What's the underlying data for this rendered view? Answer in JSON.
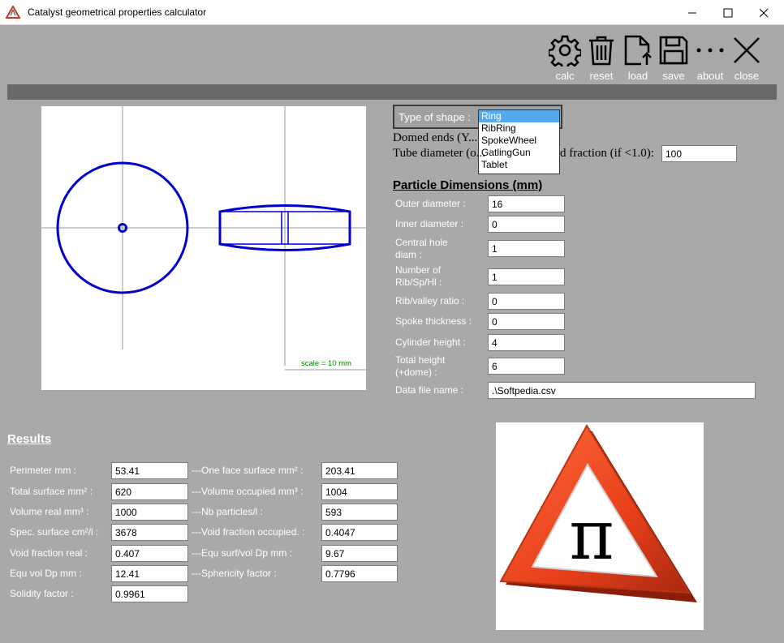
{
  "window": {
    "title": "Catalyst geometrical properties calculator"
  },
  "toolbar": {
    "calc": "calc",
    "reset": "reset",
    "load": "load",
    "save": "save",
    "about": "about",
    "close": "close"
  },
  "preview": {
    "scale_label": "scale = 10 mm",
    "shape_color": "#0000cc"
  },
  "shape": {
    "label": "Type of shape :",
    "options": [
      "Ring",
      "RibRing",
      "SpokeWheel",
      "GatlingGun",
      "Tablet"
    ],
    "selected": "Ring"
  },
  "domed_ends_label": "Domed ends (Y...",
  "tube_diameter_label": "Tube diameter (o...",
  "void_fraction_suffix": "d fraction (if <1.0):",
  "tube_diameter_value": "100",
  "dimensions": {
    "title": "Particle Dimensions (mm)",
    "outer_diameter": {
      "label": "Outer diameter :",
      "value": "16"
    },
    "inner_diameter": {
      "label": "Inner diameter :",
      "value": "0"
    },
    "central_hole": {
      "label": "Central hole diam :",
      "value": "1"
    },
    "number_rib": {
      "label": "Number of Rib/Sp/Hl :",
      "value": "1"
    },
    "rib_valley": {
      "label": "Rib/valley ratio :",
      "value": "0"
    },
    "spoke_thickness": {
      "label": "Spoke thickness :",
      "value": "0"
    },
    "cylinder_height": {
      "label": "Cylinder height :",
      "value": "4"
    },
    "total_height": {
      "label": "Total height (+dome) :",
      "value": "6"
    },
    "data_file": {
      "label": "Data file name :",
      "value": ".\\Softpedia.csv"
    }
  },
  "results": {
    "title": "Results",
    "perimeter": {
      "label": "Perimeter mm :",
      "value": "53.41"
    },
    "total_surface": {
      "label": "Total surface mm² :",
      "value": "620"
    },
    "volume_real": {
      "label": "Volume real mm³ :",
      "value": "1000"
    },
    "spec_surface": {
      "label": "Spec. surface cm²/l :",
      "value": "3678"
    },
    "void_fraction_real": {
      "label": "Void fraction real :",
      "value": "0.407"
    },
    "equ_vol_dp": {
      "label": "Equ vol Dp mm :",
      "value": "12.41"
    },
    "solidity": {
      "label": "Solidity factor :",
      "value": "0.9961"
    },
    "one_face_surface": {
      "label": "---One face surface mm² :",
      "value": "203.41"
    },
    "volume_occupied": {
      "label": "---Volume occupied mm³ :",
      "value": "1004"
    },
    "nb_particles": {
      "label": "---Nb particles/l :",
      "value": "593"
    },
    "void_fraction_occupied": {
      "label": "---Void fraction occupied. :",
      "value": "0.4047"
    },
    "equ_surf_vol": {
      "label": "---Equ surf/vol Dp mm :",
      "value": "9.67"
    },
    "sphericity": {
      "label": "---Sphericity factor :",
      "value": "0.7796"
    }
  },
  "warning_sign": {
    "symbol": "π"
  }
}
